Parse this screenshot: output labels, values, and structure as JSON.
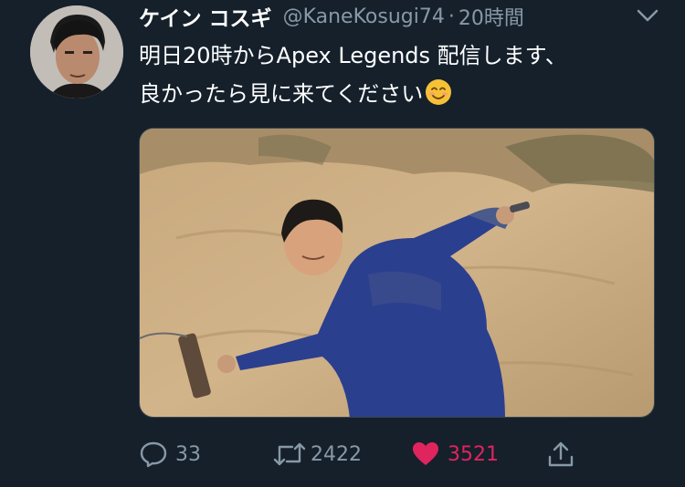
{
  "tweet": {
    "display_name": "ケイン コスギ",
    "handle": "@KaneKosugi74",
    "separator": "·",
    "time": "20時間",
    "text_line1": "明日20時からApex Legends 配信します、",
    "text_line2": "良かったら見に来てください",
    "emoji": "smiling-face-icon"
  },
  "actions": {
    "reply_count": "33",
    "retweet_count": "2422",
    "like_count": "3521"
  },
  "colors": {
    "background": "#15202b",
    "secondary_text": "#8899a6",
    "like": "#e0245e",
    "border": "#38444d"
  }
}
